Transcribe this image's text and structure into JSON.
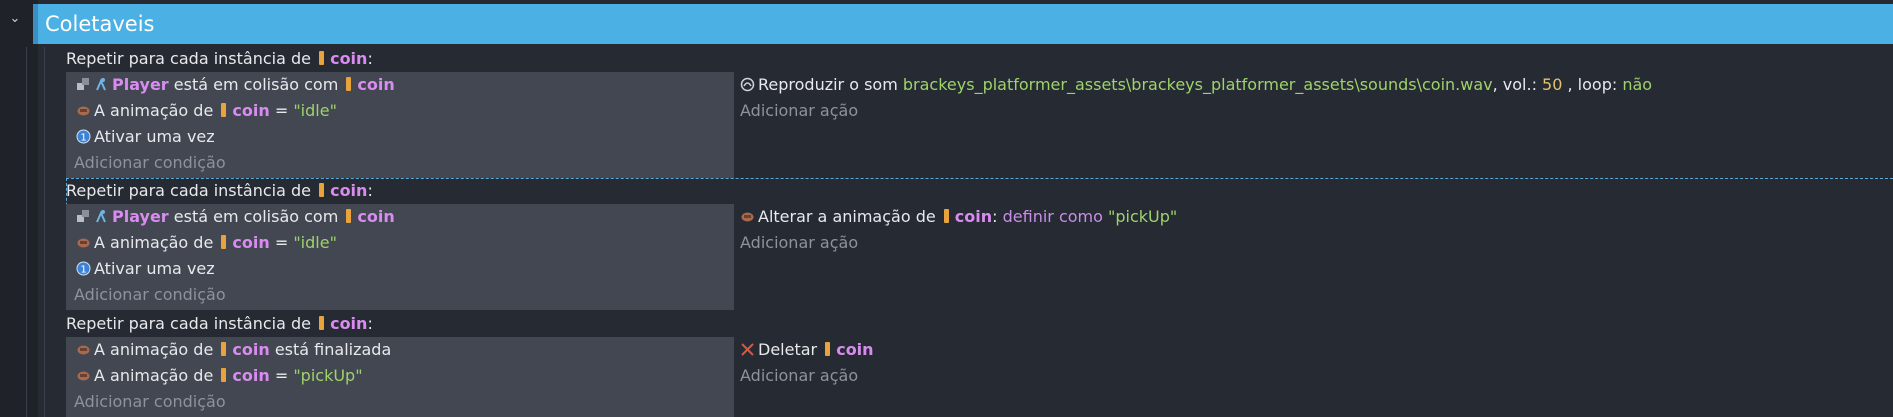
{
  "group": {
    "title": "Coletaveis",
    "collapse_icon": "chevron-down-icon",
    "accent": "#4bb0e4"
  },
  "object_name": "coin",
  "player_name": "Player",
  "add_condition": "Adicionar condição",
  "add_action": "Adicionar ação",
  "events": [
    {
      "header": "Repetir para cada instância de",
      "header_suffix": ":",
      "conditions": [
        {
          "pre": "",
          "mid": " está em colisão com ",
          "post": ""
        },
        {
          "pre": "A animação de ",
          "op": " = ",
          "val": "\"idle\""
        },
        {
          "text": "Ativar uma vez"
        }
      ],
      "action": {
        "prefix": "Reproduzir o som ",
        "path": "brackeys_platformer_assets\\brackeys_platformer_assets\\sounds\\coin.wav",
        "vol_label": ", vol.: ",
        "vol": "50",
        "loop_label": " , loop: ",
        "loop": "não"
      }
    },
    {
      "header": "Repetir para cada instância de",
      "header_suffix": ":",
      "conditions": [
        {
          "mid": " está em colisão com "
        },
        {
          "pre": "A animação de ",
          "op": " = ",
          "val": "\"idle\""
        },
        {
          "text": "Ativar uma vez"
        }
      ],
      "action": {
        "prefix": "Alterar a animação de ",
        "colon": ": ",
        "setter": "definir como ",
        "val": "\"pickUp\""
      }
    },
    {
      "header": "Repetir para cada instância de",
      "header_suffix": ":",
      "conditions": [
        {
          "pre": "A animação de ",
          "post": " está finalizada"
        },
        {
          "pre": "A animação de ",
          "op": " = ",
          "val": "\"pickUp\""
        }
      ],
      "action": {
        "prefix": "Deletar "
      }
    }
  ],
  "colors": {
    "background": "#262a33",
    "condition_panel": "#424751",
    "object_keyword": "#d98cf0",
    "string": "#9ed36a",
    "number": "#e2c26a"
  }
}
